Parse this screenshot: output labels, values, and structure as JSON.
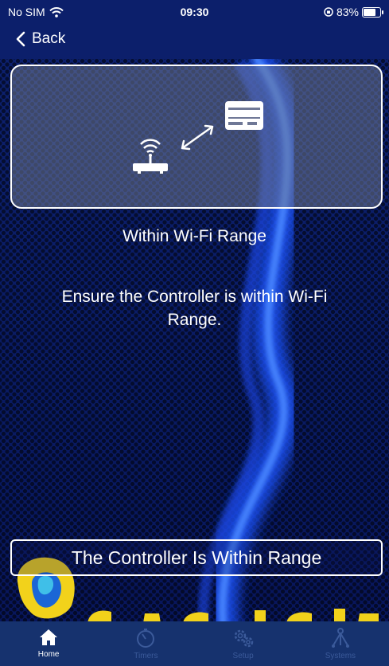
{
  "status_bar": {
    "carrier": "No SIM",
    "time": "09:30",
    "battery_percent": "83%",
    "battery_level": 0.83
  },
  "nav": {
    "back_label": "Back"
  },
  "content": {
    "title": "Within Wi-Fi Range",
    "description": "Ensure the Controller is within Wi-Fi Range."
  },
  "confirm_button": {
    "label": "The Controller Is Within Range"
  },
  "tabs": [
    {
      "label": "Home",
      "icon": "home-icon",
      "active": true
    },
    {
      "label": "Timers",
      "icon": "timer-icon",
      "active": false
    },
    {
      "label": "Setup",
      "icon": "gears-icon",
      "active": false
    },
    {
      "label": "Systems",
      "icon": "systems-icon",
      "active": false
    }
  ],
  "colors": {
    "background": "#0a1a5c",
    "bar": "#0c1f6b",
    "tab_bar": "#16326e",
    "glow": "#2e6cff",
    "logo_yellow": "#f2d21b"
  }
}
